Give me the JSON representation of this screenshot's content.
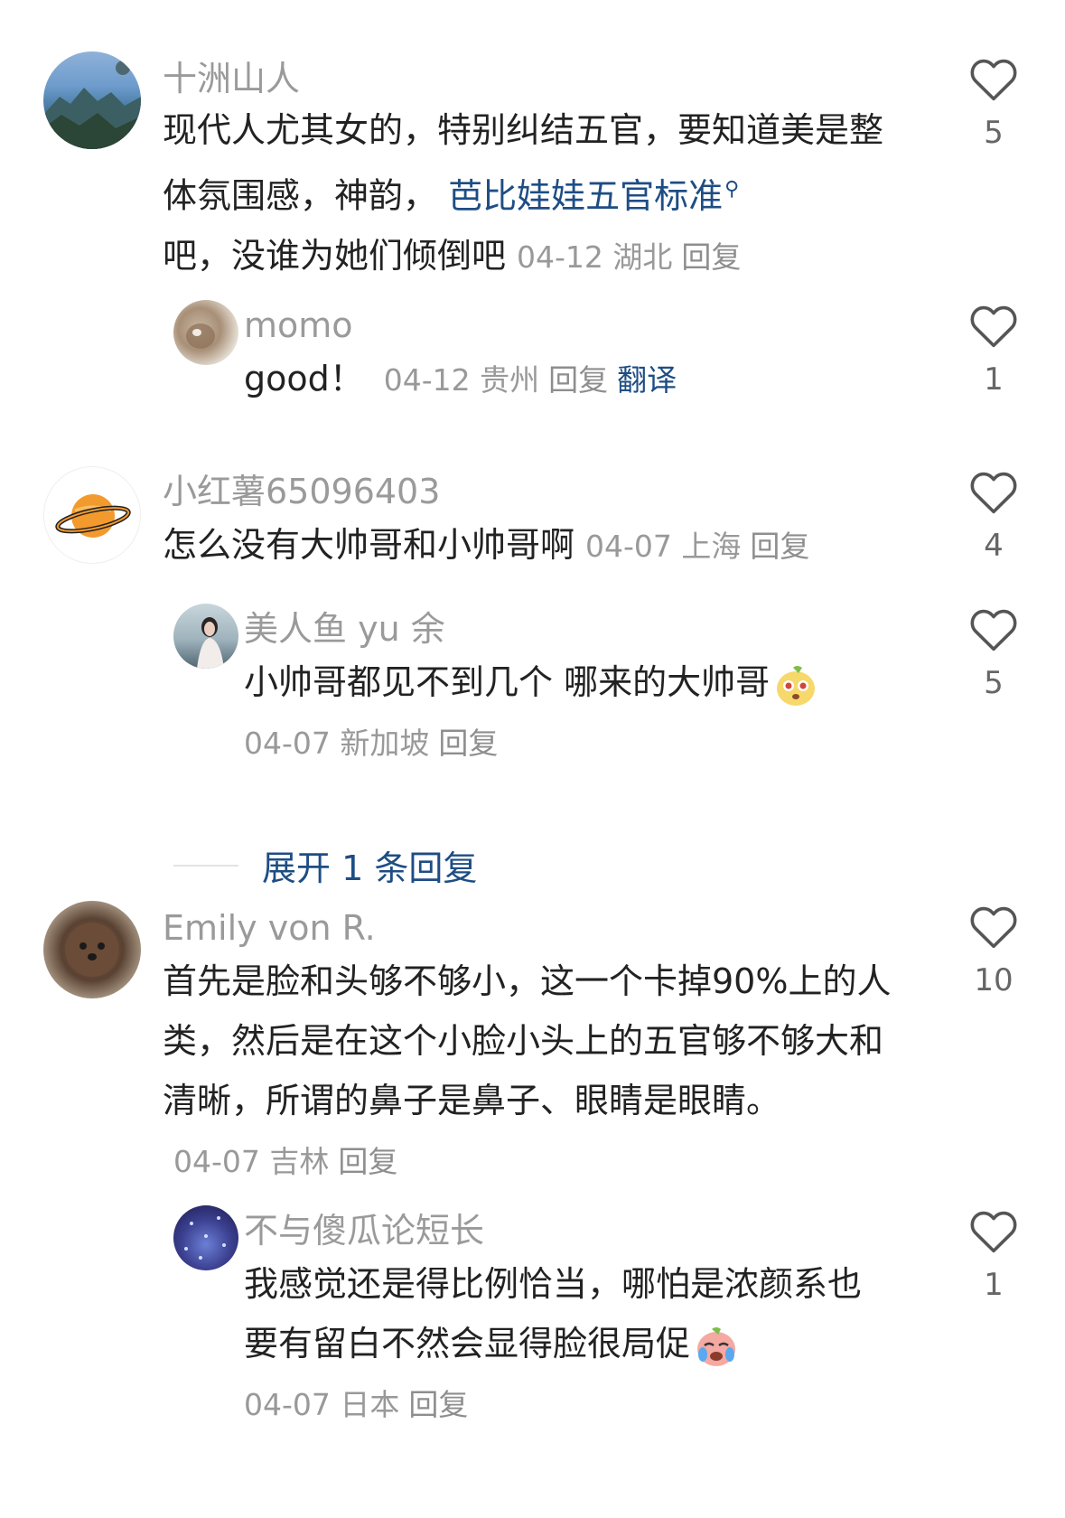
{
  "comments": [
    {
      "username": "十洲山人",
      "text_before": "现代人尤其女的，特别纠结五官，要知道美是整体氛围感，神韵，",
      "link_text": "芭比娃娃五官标准",
      "text_after": "吧，没谁为她们倾倒吧",
      "date": "04-12",
      "location": "湖北",
      "reply": "回复",
      "likes": "5",
      "avatar_icon": "mountain-landscape-avatar"
    },
    {
      "username": "momo",
      "text": "good！",
      "date": "04-12",
      "location": "贵州",
      "reply": "回复",
      "translate": "翻译",
      "likes": "1",
      "avatar_icon": "cat-avatar"
    },
    {
      "username": "小红薯65096403",
      "text": "怎么没有大帅哥和小帅哥啊",
      "date": "04-07",
      "location": "上海",
      "reply": "回复",
      "likes": "4",
      "avatar_icon": "orange-planet-avatar"
    },
    {
      "username": "美人鱼 yu 余",
      "text": "小帅哥都见不到几个 哪来的大帅哥",
      "date": "04-07",
      "location": "新加坡",
      "reply": "回复",
      "likes": "5",
      "avatar_icon": "girl-portrait-avatar",
      "emoji_icon": "surprised-pear-emoji"
    },
    {
      "username": "Emily von R.",
      "text": "首先是脸和头够不够小，这一个卡掉90%上的人类，然后是在这个小脸小头上的五官够不够大和清晰，所谓的鼻子是鼻子、眼睛是眼睛。",
      "date": "04-07",
      "location": "吉林",
      "reply": "回复",
      "likes": "10",
      "avatar_icon": "poodle-dog-avatar"
    },
    {
      "username": "不与傻瓜论短长",
      "text": "我感觉还是得比例恰当，哪怕是浓颜系也要有留白不然会显得脸很局促",
      "date": "04-07",
      "location": "日本",
      "reply": "回复",
      "likes": "1",
      "avatar_icon": "night-lights-avatar",
      "emoji_icon": "crying-face-emoji"
    }
  ],
  "expand_replies": "展开 1 条回复",
  "colors": {
    "username": "#9a9a9a",
    "text": "#222222",
    "meta": "#999999",
    "link": "#1e4d84",
    "heart": "#555555"
  },
  "icons": {
    "like": "heart-outline-icon"
  }
}
